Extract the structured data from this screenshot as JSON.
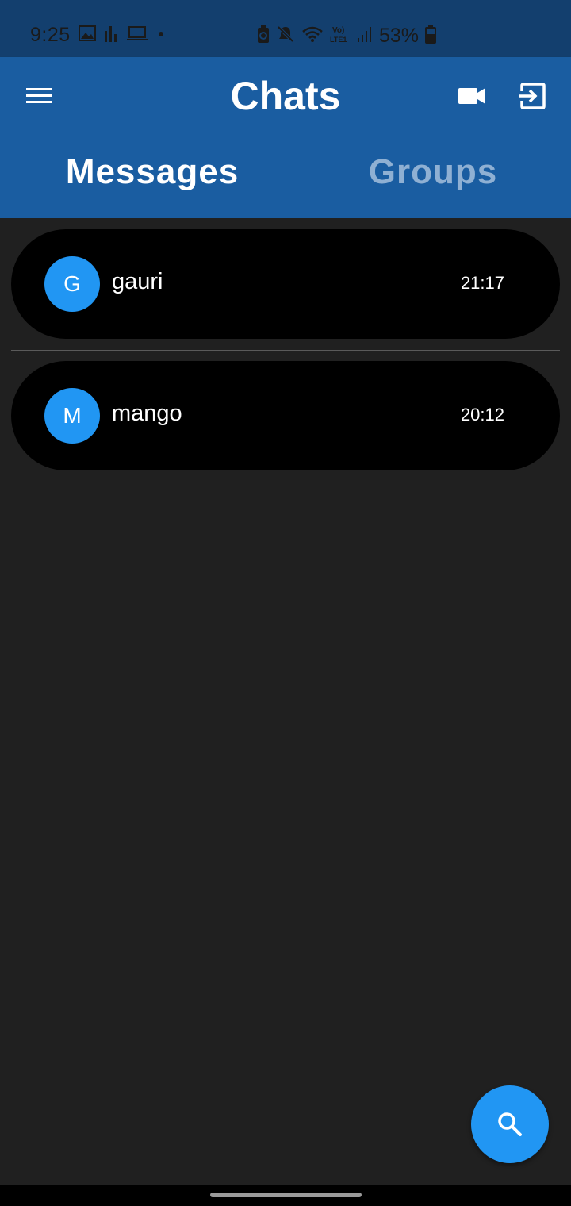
{
  "status_bar": {
    "time": "9:25",
    "battery": "53%",
    "icons": [
      "gallery-icon",
      "stats-icon",
      "laptop-icon",
      "dot-icon",
      "battery-saver-icon",
      "mute-icon",
      "wifi-icon",
      "volte-icon",
      "signal-icon",
      "battery-icon"
    ]
  },
  "app_bar": {
    "title": "Chats",
    "left_icon": "menu-icon",
    "right_icons": [
      "video-camera-icon",
      "exit-icon"
    ]
  },
  "tabs": [
    {
      "label": "Messages",
      "active": true
    },
    {
      "label": "Groups",
      "active": false
    }
  ],
  "chats": [
    {
      "initial": "G",
      "name": "gauri",
      "time": "21:17"
    },
    {
      "initial": "M",
      "name": "mango",
      "time": "20:12"
    }
  ],
  "fab": {
    "icon": "search-icon"
  },
  "colors": {
    "status_bar": "#133f6e",
    "app_bar": "#1a5da1",
    "accent": "#2196f3",
    "background": "#202020",
    "chat_item": "#000000",
    "inactive_tab": "#8fb0d3"
  }
}
